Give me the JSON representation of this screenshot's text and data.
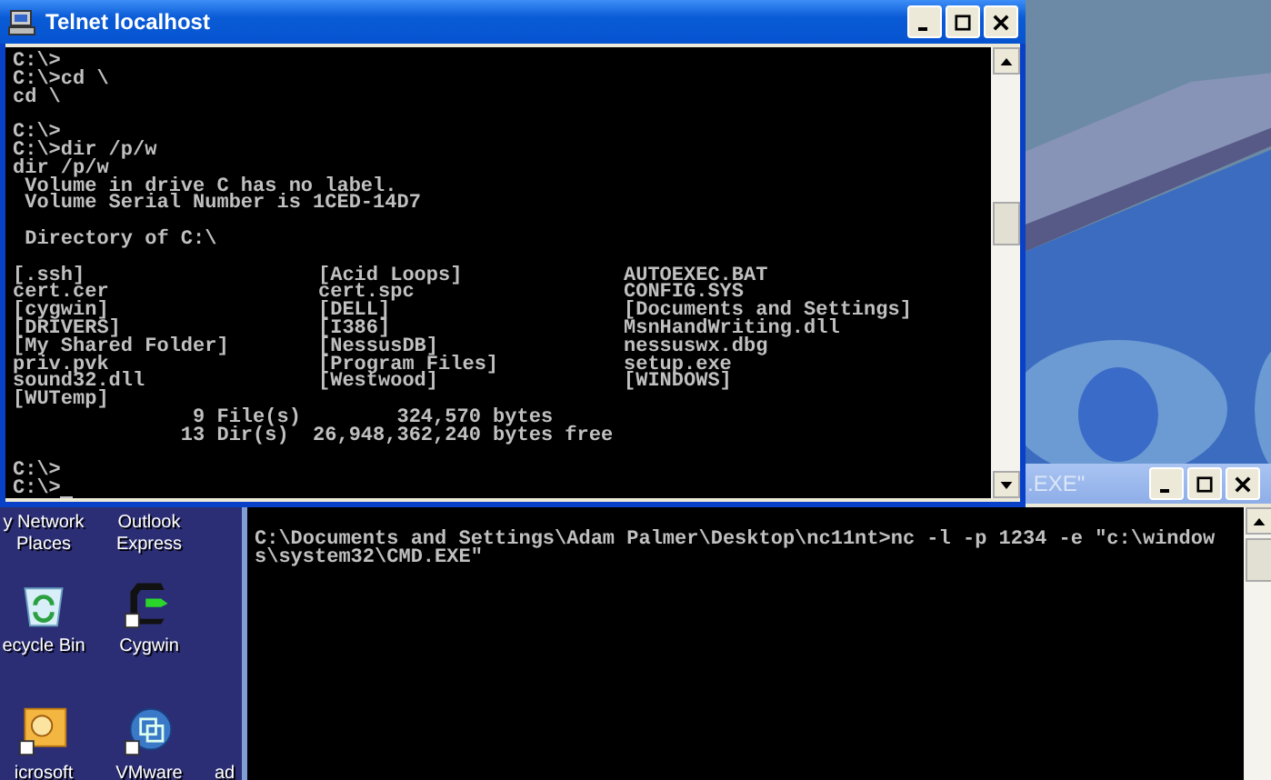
{
  "telnet_window": {
    "title": "Telnet localhost",
    "active": true,
    "blocks_before": [
      [
        "C:\\>",
        "C:\\>cd \\",
        "cd \\"
      ],
      [
        "C:\\>",
        "C:\\>dir /p/w",
        "dir /p/w",
        " Volume in drive C has no label.",
        " Volume Serial Number is 1CED-14D7"
      ],
      [
        " Directory of C:\\"
      ]
    ],
    "listing": [
      [
        "[.ssh]",
        "[Acid Loops]",
        "AUTOEXEC.BAT"
      ],
      [
        "cert.cer",
        "cert.spc",
        "CONFIG.SYS"
      ],
      [
        "[cygwin]",
        "[DELL]",
        "[Documents and Settings]"
      ],
      [
        "[DRIVERS]",
        "[I386]",
        "MsnHandWriting.dll"
      ],
      [
        "[My Shared Folder]",
        "[NessusDB]",
        "nessuswx.dbg"
      ],
      [
        "priv.pvk",
        "[Program Files]",
        "setup.exe"
      ],
      [
        "sound32.dll",
        "[Westwood]",
        "[WINDOWS]"
      ],
      [
        "[WUTemp]"
      ]
    ],
    "summary": [
      "               9 File(s)        324,570 bytes",
      "              13 Dir(s)  26,948,362,240 bytes free"
    ],
    "prompt_lines": [
      "C:\\>",
      "C:\\>"
    ]
  },
  "cmd_window": {
    "title": ".EXE\"",
    "active": false,
    "lines": [
      "C:\\Documents and Settings\\Adam Palmer\\Desktop\\nc11nt>nc -l -p 1234 -e \"c:\\window",
      "s\\system32\\CMD.EXE\""
    ]
  },
  "desktop_icons": [
    {
      "kind": "network",
      "label_lines": [
        "y Network",
        "Places"
      ]
    },
    {
      "kind": "mail",
      "label_lines": [
        "Outlook",
        "Express"
      ]
    },
    {
      "kind": "recycle",
      "label_lines": [
        "ecycle Bin"
      ]
    },
    {
      "kind": "cygwin",
      "label_lines": [
        "Cygwin"
      ]
    },
    {
      "kind": "office",
      "label_lines": [
        "icrosoft"
      ]
    },
    {
      "kind": "vmware",
      "label_lines": [
        "VMware"
      ]
    },
    {
      "kind": "none",
      "label_lines": [
        "ad"
      ]
    }
  ]
}
